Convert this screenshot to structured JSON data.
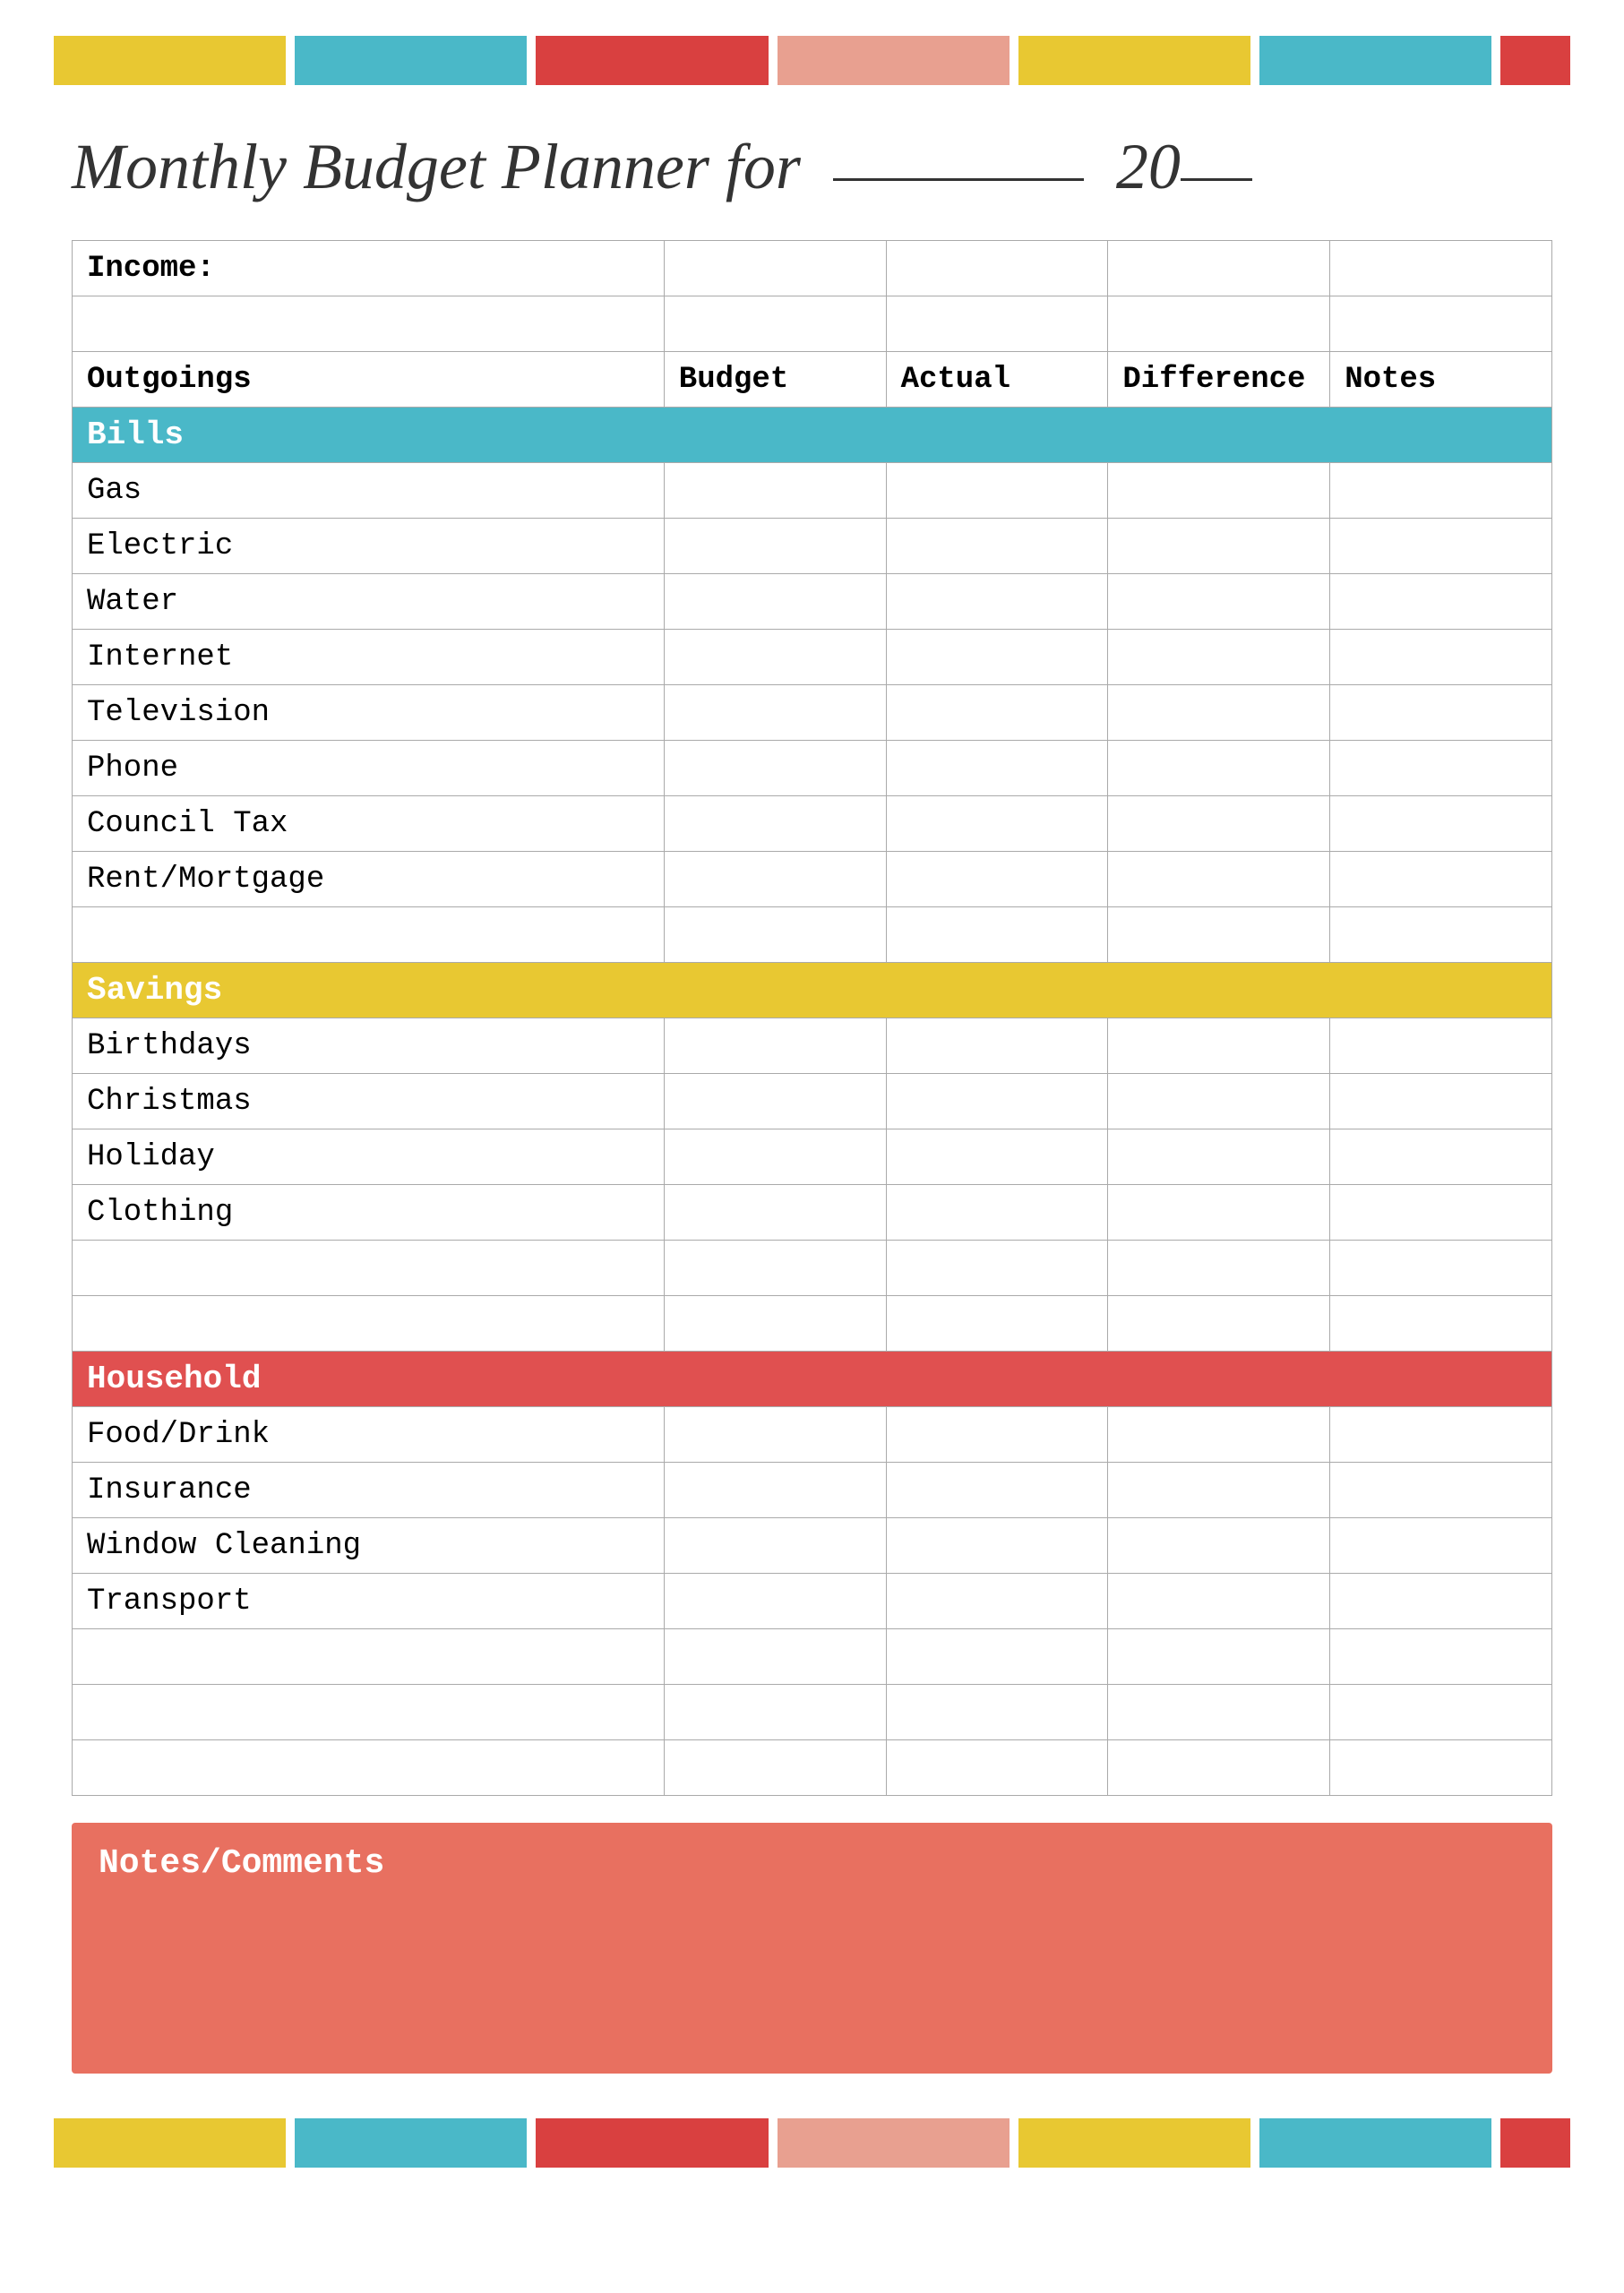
{
  "page": {
    "title": "Monthly Budget Planner for",
    "year_prefix": "20",
    "year_suffix": "__"
  },
  "topBar": {
    "segments": [
      "yellow",
      "teal",
      "red",
      "salmon",
      "yellow2",
      "teal2",
      "red2"
    ]
  },
  "table": {
    "income_label": "Income:",
    "headers": {
      "outgoings": "Outgoings",
      "budget": "Budget",
      "actual": "Actual",
      "difference": "Difference",
      "notes": "Notes"
    },
    "categories": {
      "bills": "Bills",
      "savings": "Savings",
      "household": "Household"
    },
    "bills_rows": [
      "Gas",
      "Electric",
      "Water",
      "Internet",
      "Television",
      "Phone",
      "Council Tax",
      "Rent/Mortgage"
    ],
    "savings_rows": [
      "Birthdays",
      "Christmas",
      "Holiday",
      "Clothing"
    ],
    "household_rows": [
      "Food/Drink",
      "Insurance",
      "Window Cleaning",
      "Transport"
    ]
  },
  "notes_section": {
    "title": "Notes/Comments"
  },
  "bottomBar": {
    "segments": [
      "yellow",
      "teal",
      "red",
      "salmon",
      "yellow2",
      "teal2",
      "red2"
    ]
  }
}
